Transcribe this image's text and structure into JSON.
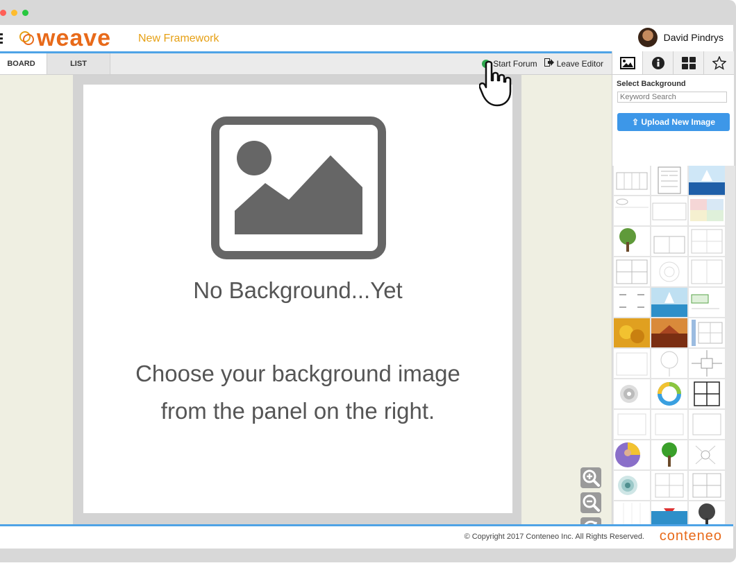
{
  "app": {
    "logo_text": "weave",
    "framework_title": "New Framework",
    "user_name": "David Pindrys"
  },
  "tabs": [
    {
      "label": "BOARD",
      "active": true
    },
    {
      "label": "LIST",
      "active": false
    }
  ],
  "actions": {
    "start_forum": "Start Forum",
    "leave_editor": "Leave Editor"
  },
  "canvas": {
    "heading": "No Background...Yet",
    "line1": "Choose your background image",
    "line2": "from the panel on the right."
  },
  "panel": {
    "tabs": [
      "image-icon",
      "info-icon",
      "grid-icon",
      "star-icon"
    ],
    "title": "Select Background",
    "search_placeholder": "Keyword Search",
    "upload_label": "Upload New Image"
  },
  "footer": {
    "copyright": "© Copyright 2017 Conteneo Inc. All Rights Reserved.",
    "brand": "conteneo"
  },
  "colors": {
    "accent_blue": "#4ea3e6",
    "brand_orange": "#e86a1a",
    "title_gold": "#e6a015",
    "go_green": "#2fa84f"
  }
}
